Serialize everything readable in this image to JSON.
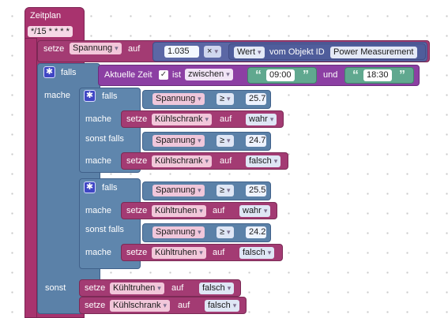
{
  "schedule": {
    "label": "Zeitplan",
    "cron": "*/15 * * * *"
  },
  "keywords": {
    "set": "setze",
    "to": "auf",
    "if": "falls",
    "do": "mache",
    "else_if": "sonst falls",
    "else": "sonst",
    "is": "ist",
    "and": "und",
    "from_object_id": "vom Objekt ID"
  },
  "set_voltage": {
    "variable": "Spannung",
    "multiplier": "1.035",
    "operator": "×",
    "property": "Wert",
    "object_id": "Power Measurement"
  },
  "time_check": {
    "label": "Aktuelle Zeit",
    "checked": "✓",
    "mode": "zwischen",
    "from": "09:00",
    "to": "18:30"
  },
  "if_block_1": {
    "cond1": {
      "variable": "Spannung",
      "operator": "≥",
      "value": "25.7"
    },
    "do1": {
      "variable": "Kühlschrank",
      "value": "wahr"
    },
    "cond2": {
      "variable": "Spannung",
      "operator": "≥",
      "value": "24.7"
    },
    "do2": {
      "variable": "Kühlschrank",
      "value": "falsch"
    }
  },
  "if_block_2": {
    "cond1": {
      "variable": "Spannung",
      "operator": "≥",
      "value": "25.5"
    },
    "do1": {
      "variable": "Kühltruhen",
      "value": "wahr"
    },
    "cond2": {
      "variable": "Spannung",
      "operator": "≥",
      "value": "24.2"
    },
    "do2": {
      "variable": "Kühltruhen",
      "value": "falsch"
    }
  },
  "else_branch": {
    "set1": {
      "variable": "Kühltruhen",
      "value": "falsch"
    },
    "set2": {
      "variable": "Kühlschrank",
      "value": "falsch"
    }
  }
}
